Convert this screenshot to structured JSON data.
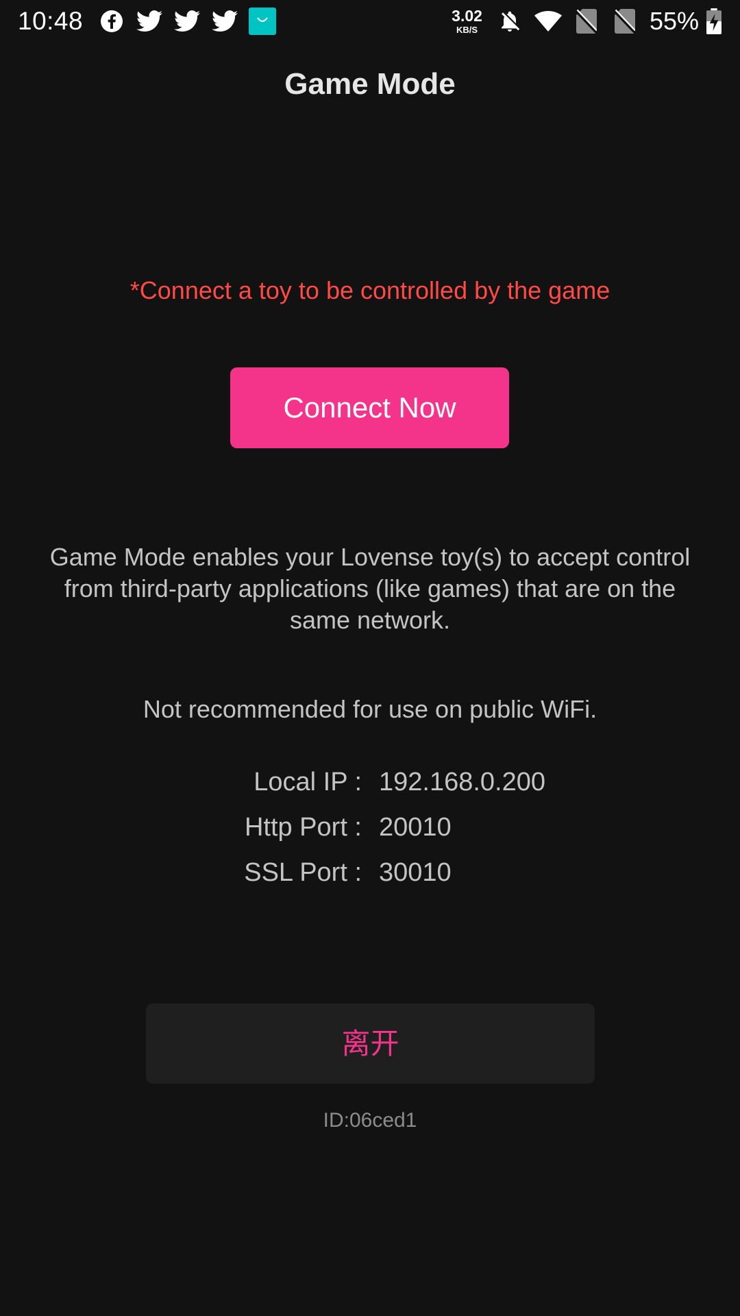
{
  "status_bar": {
    "time": "10:48",
    "notification_icons": [
      "facebook-icon",
      "twitter-icon",
      "twitter-icon",
      "twitter-icon",
      "shopping-bag-icon"
    ],
    "net_speed_value": "3.02",
    "net_speed_unit": "KB/S",
    "right_icons": [
      "bell-off-icon",
      "wifi-icon",
      "no-sim-icon",
      "no-sim-icon"
    ],
    "battery_percent": "55%"
  },
  "header": {
    "title": "Game Mode"
  },
  "main": {
    "hint": "*Connect a toy to be controlled by the game",
    "connect_button_label": "Connect Now",
    "description": "Game Mode enables your Lovense toy(s) to accept control from third-party applications (like games) that are on the same network.",
    "warning": "Not recommended for use on public WiFi.",
    "info": [
      {
        "label": "Local IP :",
        "value": "192.168.0.200"
      },
      {
        "label": "Http Port :",
        "value": "20010"
      },
      {
        "label": "SSL Port :",
        "value": "30010"
      }
    ],
    "leave_button_label": "离开",
    "device_id": "ID:06ced1"
  },
  "colors": {
    "background": "#121212",
    "accent": "#f4348b",
    "hint": "#ff4a45",
    "leave_button_bg": "#1f1f1f"
  }
}
